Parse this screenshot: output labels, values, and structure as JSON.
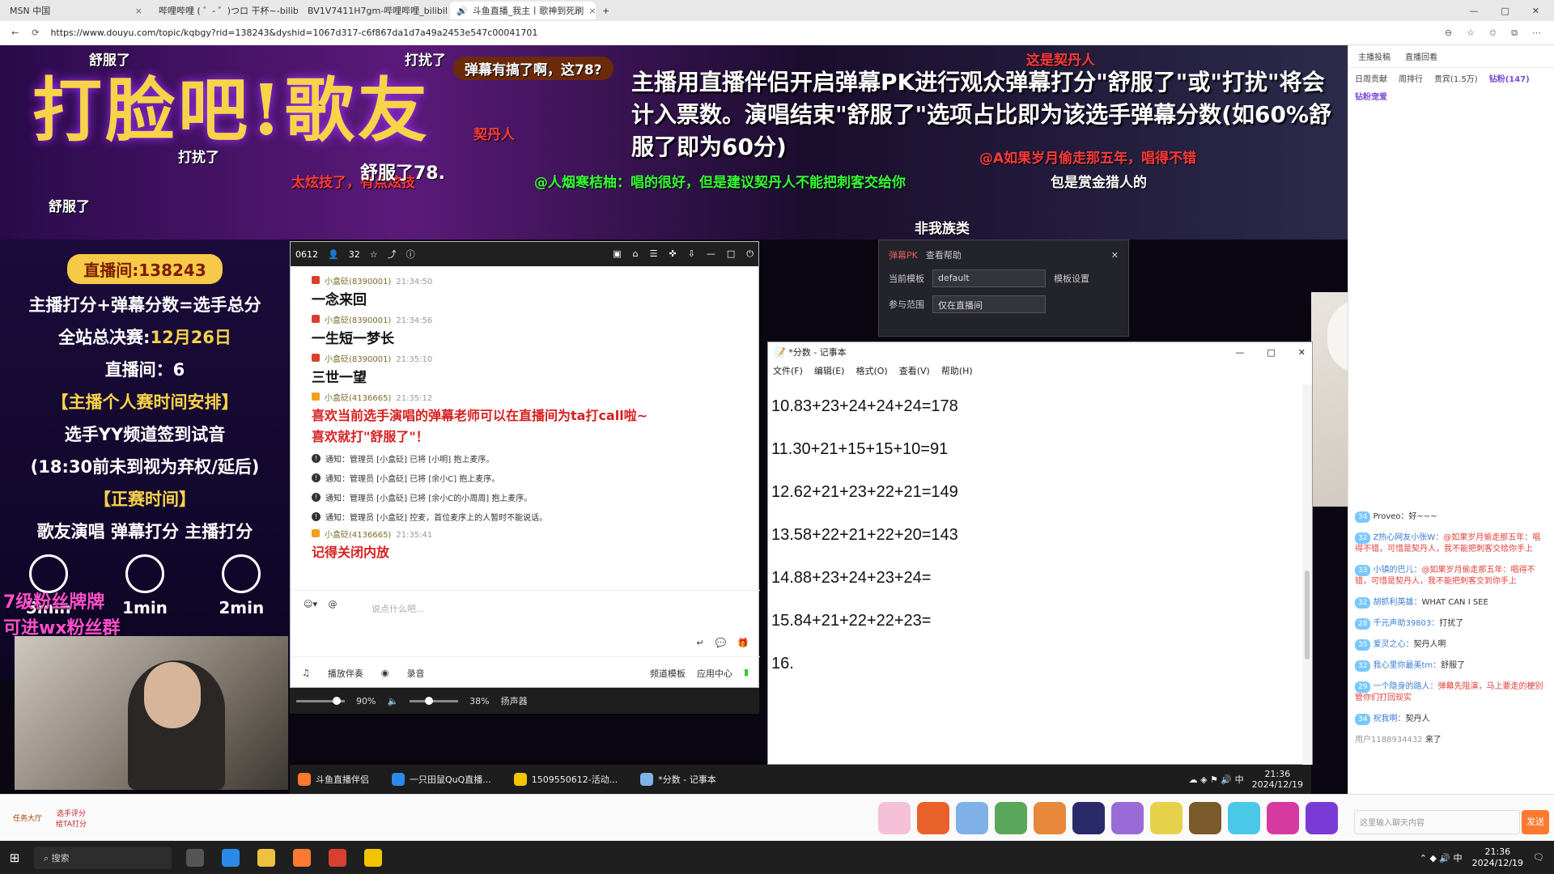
{
  "browser": {
    "tabs": [
      {
        "label": "MSN 中国",
        "active": false
      },
      {
        "label": "哔哩哔哩 ( ゜- ゜)つロ 干杯~-bilibi",
        "active": false
      },
      {
        "label": "BV1V7411H7gm-哔哩哔哩_bilibili",
        "active": false
      },
      {
        "label": "斗鱼直播_我主丨歌神到死刷",
        "active": true
      }
    ],
    "url": "https://www.douyu.com/topic/kqbgy?rid=138243&dyshid=1067d317-c6f867da1d7a49a2453e547c00041701"
  },
  "overlay": {
    "title": "打脸吧!歌友",
    "notice": "主播用直播伴侣开启弹幕PK进行观众弹幕打分\"舒服了\"或\"打扰\"将会计入票数。演唱结束\"舒服了\"选项占比即为该选手弹幕分数(如60%舒服了即为60分)",
    "popup": "弹幕有搞了啊，这78?",
    "left": {
      "room_pill": "直播间:138243",
      "formula": "主播打分+弹幕分数=选手总分",
      "final_label": "全站总决赛:",
      "final_date": "12月26日",
      "final_room": "直播间：6",
      "schedule_title": "【主播个人赛时间安排】",
      "checkin": "选手YY频道签到试音",
      "deadline": "(18:30前未到视为弃权/延后)",
      "order_title": "【正赛时间】",
      "order": "歌友演唱  弹幕打分  主播打分",
      "durations": [
        "5min",
        "1min",
        "2min"
      ],
      "fan_note": "7级粉丝牌牌",
      "fan_note2": "可进wx粉丝群"
    }
  },
  "danmu": [
    {
      "text": "舒服了",
      "color": "#ffffff"
    },
    {
      "text": "打扰了",
      "color": "#ffffff"
    },
    {
      "text": "这是契丹人",
      "color": "#ff3b3b"
    },
    {
      "text": "契丹人",
      "color": "#ff3b3b"
    },
    {
      "text": "舒服了",
      "color": "#ffffff"
    },
    {
      "text": "@人烟寒桔柚：唱的很好，但是建议契丹人不能把刺客交给你",
      "color": "#33ff33"
    },
    {
      "text": "包是赏金猎人的",
      "color": "#ffffff"
    },
    {
      "text": "非我族类",
      "color": "#ffffff"
    },
    {
      "text": "@A如果岁月偷走那五年，唱得不错",
      "color": "#ff3b3b"
    },
    {
      "text": "太炫技了，有点炫技",
      "color": "#ff3b3b"
    },
    {
      "text": "舒服了78.",
      "color": "#ffffff"
    },
    {
      "text": "打扰了",
      "color": "#ffffff"
    }
  ],
  "pk_panel": {
    "title": "弹幕PK",
    "help": "查看帮助",
    "template_label": "当前模板",
    "template_value": "default",
    "template_link": "模板设置",
    "scope_label": "参与范围",
    "scope_value": "仅在直播间"
  },
  "chat": {
    "room": "0612",
    "viewers": "32",
    "messages": [
      {
        "user": "小盒砭(8390001)",
        "time": "21:34:50",
        "text": "一念来回",
        "style": "normal"
      },
      {
        "user": "小盒砭(8390001)",
        "time": "21:34:56",
        "text": "一生短一梦长",
        "style": "normal"
      },
      {
        "user": "小盒砭(8390001)",
        "time": "21:35:10",
        "text": "三世一望",
        "style": "normal"
      },
      {
        "user": "小盒砭(4136665)",
        "time": "21:35:12",
        "text": "喜欢当前选手演唱的弹幕老师可以在直播间为ta打call啦~",
        "text2": "喜欢就打\"舒服了\"！",
        "style": "red"
      }
    ],
    "notices": [
      "通知：管理员 [小盒砭] 已将 [小明] 抱上麦序。",
      "通知：管理员 [小盒砭] 已将 [余小C] 抱上麦序。",
      "通知：管理员 [小盒砭] 已将 [余小C的小周周] 抱上麦序。",
      "通知：管理员 [小盒砭] 控麦，首位麦序上的人暂时不能说话。"
    ],
    "last": {
      "user": "小盒砭(4136665)",
      "time": "21:35:41",
      "text": "记得关闭内放"
    },
    "placeholder": "说点什么吧...",
    "bottom": {
      "accompany": "播放伴奏",
      "record": "录音",
      "template": "频道模板",
      "app_center": "应用中心"
    },
    "volume": {
      "mic": "90%",
      "speaker": "38%",
      "speaker_label": "扬声器",
      "mic_level": 0.9,
      "speaker_level": 0.38
    }
  },
  "notepad": {
    "title": "*分数 - 记事本",
    "menu": [
      "文件(F)",
      "编辑(E)",
      "格式(O)",
      "查看(V)",
      "帮助(H)"
    ],
    "lines": [
      "10.83+23+24+24+24=178",
      "11.30+21+15+15+10=91",
      "12.62+21+23+22+21=149",
      "13.58+22+21+22+20=143",
      "14.88+23+24+23+24=",
      "15.84+21+22+22+23=",
      "16."
    ]
  },
  "inner_taskbar": {
    "apps": [
      "斗鱼直播伴侣",
      "一只田鼠QuQ直播...",
      "1509550612-活动...",
      "*分数 - 记事本"
    ],
    "time": "21:36",
    "date": "2024/12/19"
  },
  "sidebar": {
    "tabs": [
      "主播投稿",
      "直播回看"
    ],
    "rank_tabs": [
      "日周贡献",
      "周排行",
      "贵宾(1.5万)",
      "钻粉(147)"
    ],
    "fans_label": "钻粉宠爱",
    "messages": [
      {
        "lv": "34",
        "name": "",
        "text": "Proveo：好~~~"
      },
      {
        "lv": "32",
        "name": "Z热心网友小张W：",
        "text": "@如果岁月偷走那五年：唱得不错，可惜是契丹人，我不能把刺客交给你手上"
      },
      {
        "lv": "33",
        "name": "小镇的巴儿：",
        "text": "@如果岁月偷走那五年：唱得不错，可惜是契丹人，我不能把刺客交到你手上"
      },
      {
        "lv": "32",
        "name": "胡抓利英雄：",
        "text": "WHAT CAN I SEE"
      },
      {
        "lv": "28",
        "name": "千元声助39803：",
        "text": "打扰了"
      },
      {
        "lv": "35",
        "name": "爱灵之心：",
        "text": "契丹人啊"
      },
      {
        "lv": "32",
        "name": "我心里你最美tm：",
        "text": "舒服了"
      },
      {
        "lv": "29",
        "name": "一个隐身的路人：",
        "text": "弹幕先阻演，马上要走的梗别管你们打回现实"
      },
      {
        "lv": "34",
        "name": "祝我啊：",
        "text": "契丹人"
      },
      {
        "lv": "",
        "name": "用户1188934432",
        "text": "来了"
      }
    ],
    "input_placeholder": "这里输入聊天内容",
    "send": "发送"
  },
  "giftbar": {
    "left": [
      "任务大厅",
      "选手评分\n给TA打分"
    ]
  },
  "taskbar": {
    "search": "搜索",
    "time": "21:36",
    "date": "2024/12/19"
  }
}
